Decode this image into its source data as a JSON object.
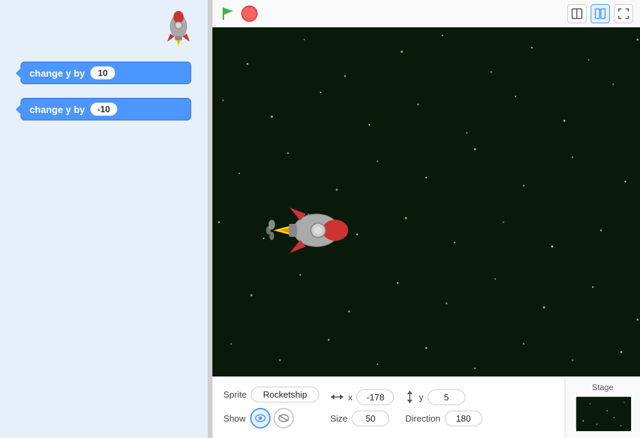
{
  "toolbar": {
    "green_flag_label": "Green Flag",
    "stop_label": "Stop",
    "layout_mode1_label": "□",
    "layout_mode2_label": "▣",
    "fullscreen_label": "⤢"
  },
  "blocks": [
    {
      "id": "block1",
      "label": "change y by",
      "value": "10"
    },
    {
      "id": "block2",
      "label": "change y by",
      "value": "-10"
    }
  ],
  "stage": {
    "title": "Stage"
  },
  "sprite": {
    "name_label": "Sprite",
    "name_value": "Rocketship",
    "x_label": "x",
    "x_value": "-178",
    "y_label": "y",
    "y_value": "5",
    "show_label": "Show",
    "size_label": "Size",
    "size_value": "50",
    "direction_label": "Direction",
    "direction_value": "180"
  },
  "colors": {
    "block_blue": "#4C97FF",
    "stage_bg": "#0a1a0a",
    "panel_bg": "#e5f0fa"
  }
}
